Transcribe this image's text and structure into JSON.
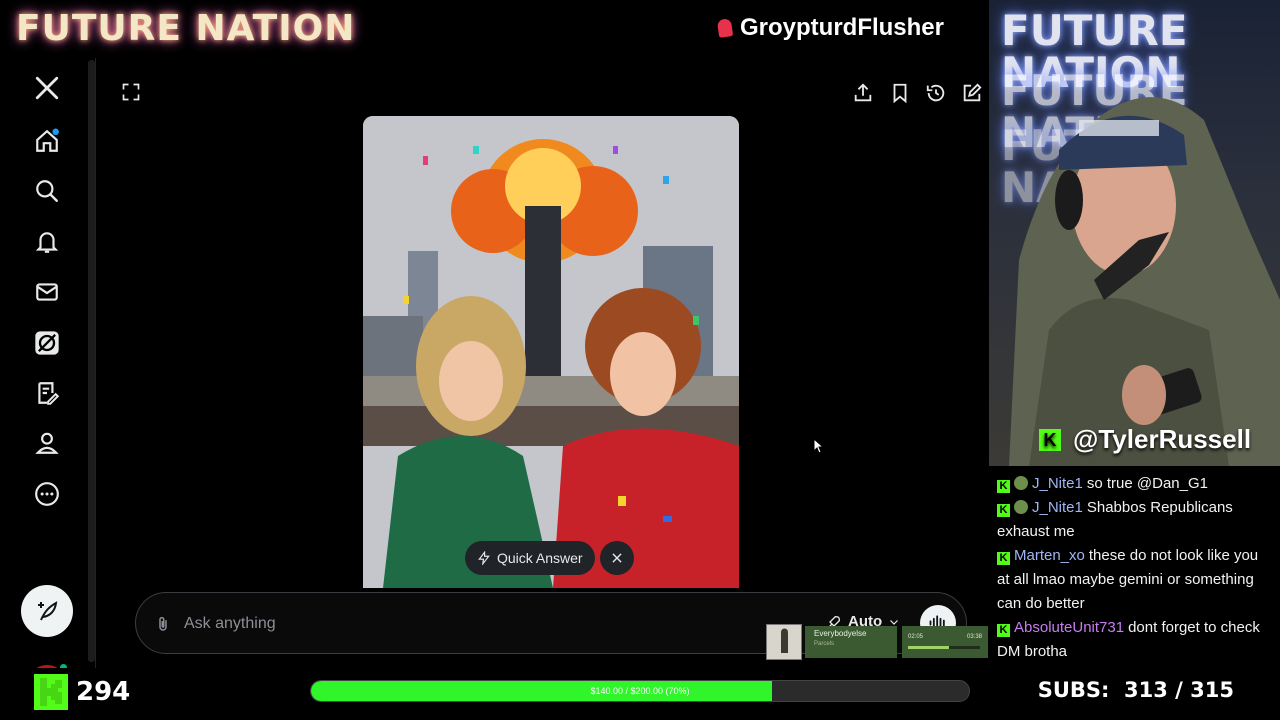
{
  "stream_overlay": {
    "brand_logo": "FUTURE NATION",
    "top_handle": "GroypturdFlusher",
    "cam_handle": "@TylerRussell",
    "webcam_overlay_text": "FUTURE NATION",
    "accent_color": "#53fc18"
  },
  "x_sidebar": {
    "items": [
      {
        "name": "x-logo-icon"
      },
      {
        "name": "home-icon"
      },
      {
        "name": "search-icon"
      },
      {
        "name": "notifications-icon"
      },
      {
        "name": "messages-icon"
      },
      {
        "name": "grok-icon"
      },
      {
        "name": "lists-icon"
      },
      {
        "name": "profile-icon"
      },
      {
        "name": "more-icon"
      }
    ]
  },
  "grok": {
    "quick_answer_label": "Quick Answer",
    "ask_placeholder": "Ask anything",
    "mode_label": "Auto",
    "tools": [
      "share-icon",
      "bookmark-icon",
      "history-icon",
      "new-chat-icon"
    ]
  },
  "now_playing": {
    "title": "Everybodyelse",
    "artist": "Parcels",
    "elapsed": "02:05",
    "duration": "03:38",
    "progress_fraction": 0.57
  },
  "chat": {
    "messages": [
      {
        "user": "J_Nite1",
        "user_color": "#9fb6f2",
        "emote": true,
        "text": "so true @Dan_G1"
      },
      {
        "user": "J_Nite1",
        "user_color": "#9fb6f2",
        "emote": true,
        "text": "Shabbos Republicans exhaust me"
      },
      {
        "user": "Marten_xo",
        "user_color": "#9fb6f2",
        "emote": false,
        "text": "these do not look like you at all lmao maybe gemini or something can do better"
      },
      {
        "user": "AbsoluteUnit731",
        "user_color": "#c77df0",
        "emote": false,
        "text": "dont forget to check DM brotha"
      }
    ]
  },
  "bottom_bar": {
    "viewer_count": "294",
    "goal_text": "$140.00 / $200.00 (70%)",
    "goal_fraction": 0.7,
    "subs_text": "SUBS:  313 / 315"
  }
}
